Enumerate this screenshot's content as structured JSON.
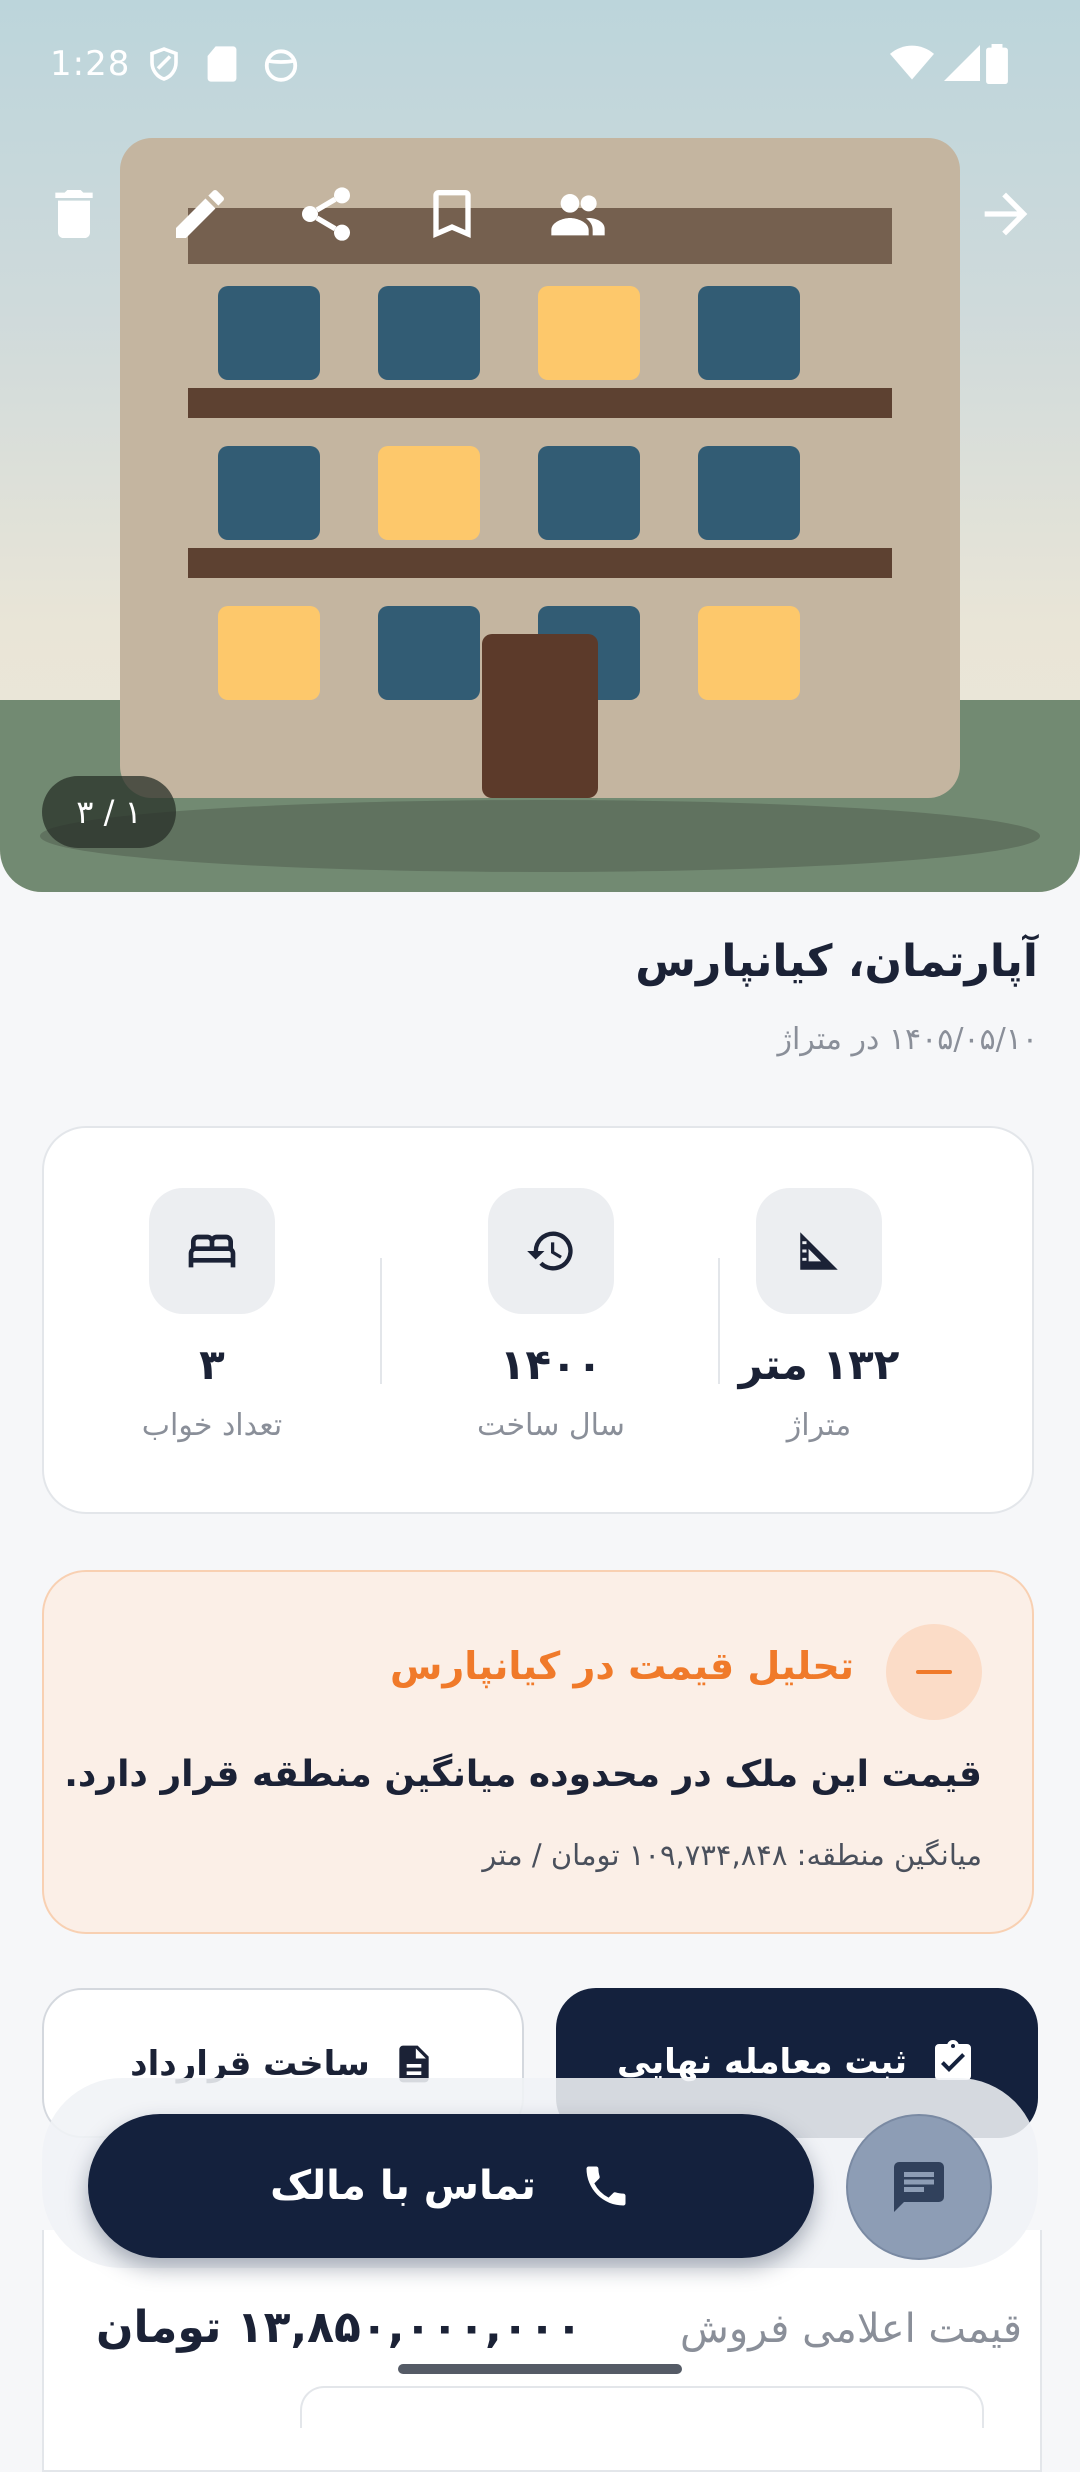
{
  "status_bar": {
    "time": "1:28"
  },
  "hero": {
    "photo_counter": "۳ / ۱"
  },
  "listing": {
    "title": "آپارتمان، کیانپارس",
    "subtitle": "۱۴۰۵/۰۵/۱۰ در متراژ"
  },
  "stats": [
    {
      "value": "۱۳۲ متر",
      "label": "متراژ",
      "icon": "set-square-icon"
    },
    {
      "value": "۱۴۰۰",
      "label": "سال ساخت",
      "icon": "history-icon"
    },
    {
      "value": "۳",
      "label": "تعداد خواب",
      "icon": "bed-icon"
    }
  ],
  "analysis": {
    "title": "تحلیل قیمت در کیانپارس",
    "body": "قیمت این ملک در محدوده میانگین منطقه قرار دارد.",
    "average": "میانگین منطقه: ۱۰۹,۷۳۴,۸۴۸ تومان / متر"
  },
  "actions": {
    "final_deal": "ثبت معامله نهایی",
    "make_contract": "ساخت قرارداد"
  },
  "contact": {
    "label": "تماس با مالک"
  },
  "price": {
    "label": "قیمت اعلامی فروش",
    "value": "۱۳,۸۵۰,۰۰۰,۰۰۰ تومان"
  },
  "colors": {
    "navy": "#14213d",
    "accent_orange": "#f07a2a",
    "analysis_bg": "#fbefe7"
  }
}
